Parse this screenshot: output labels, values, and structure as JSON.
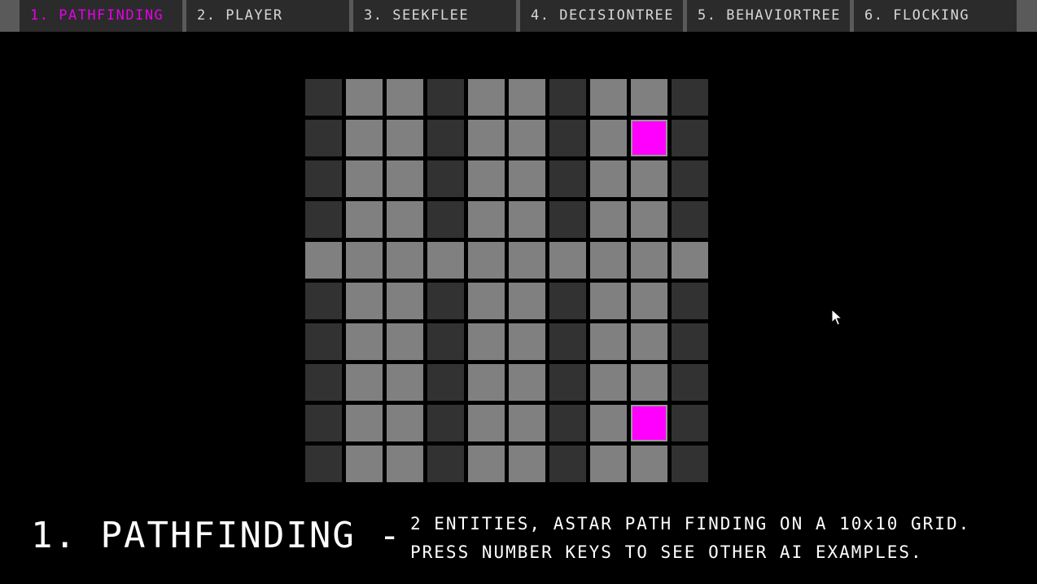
{
  "tabs": [
    {
      "label": "1. PATHFINDING",
      "active": true
    },
    {
      "label": "2. PLAYER",
      "active": false
    },
    {
      "label": "3. SEEKFLEE",
      "active": false
    },
    {
      "label": "4. DECISIONTREE",
      "active": false
    },
    {
      "label": "5. BEHAVIORTREE",
      "active": false
    },
    {
      "label": "6. FLOCKING",
      "active": false
    }
  ],
  "grid": {
    "blocked_columns": [
      0,
      3,
      6,
      9
    ],
    "open_row": 4,
    "entities": [
      {
        "row": 1,
        "col": 8
      },
      {
        "row": 8,
        "col": 8
      }
    ],
    "colors": {
      "blocked": "#323232",
      "open": "#808080",
      "entity": "#ff00ff"
    }
  },
  "footer": {
    "title": "1. PATHFINDING -",
    "line1": "2 ENTITIES, ASTAR PATH FINDING ON A 10x10 GRID.",
    "line2": "PRESS NUMBER KEYS TO SEE OTHER AI EXAMPLES."
  },
  "colors": {
    "accent": "#e600e6",
    "tab_bg": "#2b2b2b",
    "tab_text": "#d8d8d8",
    "background": "#000000"
  }
}
